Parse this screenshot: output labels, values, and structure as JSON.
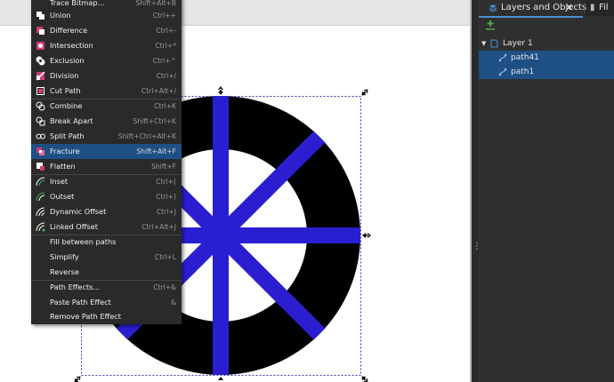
{
  "menu": {
    "items": [
      {
        "label": "Trace Bitmap...",
        "shortcut": "Shift+Alt+B",
        "icon": "trace-bitmap-icon"
      },
      {
        "label": "Union",
        "shortcut": "Ctrl++",
        "icon": "union-icon"
      },
      {
        "label": "Difference",
        "shortcut": "Ctrl+-",
        "icon": "difference-icon"
      },
      {
        "label": "Intersection",
        "shortcut": "Ctrl+*",
        "icon": "intersection-icon"
      },
      {
        "label": "Exclusion",
        "shortcut": "Ctrl+^",
        "icon": "exclusion-icon"
      },
      {
        "label": "Division",
        "shortcut": "Ctrl+/",
        "icon": "division-icon"
      },
      {
        "label": "Cut Path",
        "shortcut": "Ctrl+Alt+/",
        "icon": "cut-path-icon"
      },
      {
        "label": "Combine",
        "shortcut": "Ctrl+K",
        "icon": "combine-icon"
      },
      {
        "label": "Break Apart",
        "shortcut": "Shift+Ctrl+K",
        "icon": "break-apart-icon"
      },
      {
        "label": "Split Path",
        "shortcut": "Shift+Ctrl+Alt+K",
        "icon": "split-path-icon"
      },
      {
        "label": "Fracture",
        "shortcut": "Shift+Alt+F",
        "icon": "fracture-icon",
        "highlighted": true
      },
      {
        "label": "Flatten",
        "shortcut": "Shift+F",
        "icon": "flatten-icon"
      },
      {
        "label": "Inset",
        "shortcut": "Ctrl+(",
        "icon": "inset-icon"
      },
      {
        "label": "Outset",
        "shortcut": "Ctrl+)",
        "icon": "outset-icon"
      },
      {
        "label": "Dynamic Offset",
        "shortcut": "Ctrl+J",
        "icon": "dynamic-offset-icon"
      },
      {
        "label": "Linked Offset",
        "shortcut": "Ctrl+Alt+J",
        "icon": "linked-offset-icon"
      },
      {
        "label": "Fill between paths",
        "shortcut": "",
        "icon": ""
      },
      {
        "label": "Simplify",
        "shortcut": "Ctrl+L",
        "icon": ""
      },
      {
        "label": "Reverse",
        "shortcut": "",
        "icon": ""
      },
      {
        "label": "Path Effects...",
        "shortcut": "Ctrl+&",
        "icon": ""
      },
      {
        "label": "Paste Path Effect",
        "shortcut": "&",
        "icon": ""
      },
      {
        "label": "Remove Path Effect",
        "shortcut": "",
        "icon": ""
      }
    ]
  },
  "panel": {
    "tab_active": "Layers and Objects",
    "tab_close": "✕",
    "tab_next": "Fil",
    "tree": [
      {
        "label": "Layer 1",
        "type": "layer",
        "icon": "layer-icon"
      },
      {
        "label": "path41",
        "type": "path",
        "icon": "path-icon"
      },
      {
        "label": "path1",
        "type": "path",
        "icon": "path-icon"
      }
    ]
  },
  "colors": {
    "spoke": "#2a1fd0",
    "ring": "#000000",
    "menu_highlight": "#1e4f85",
    "selection_dash": "#3a3aa8"
  }
}
